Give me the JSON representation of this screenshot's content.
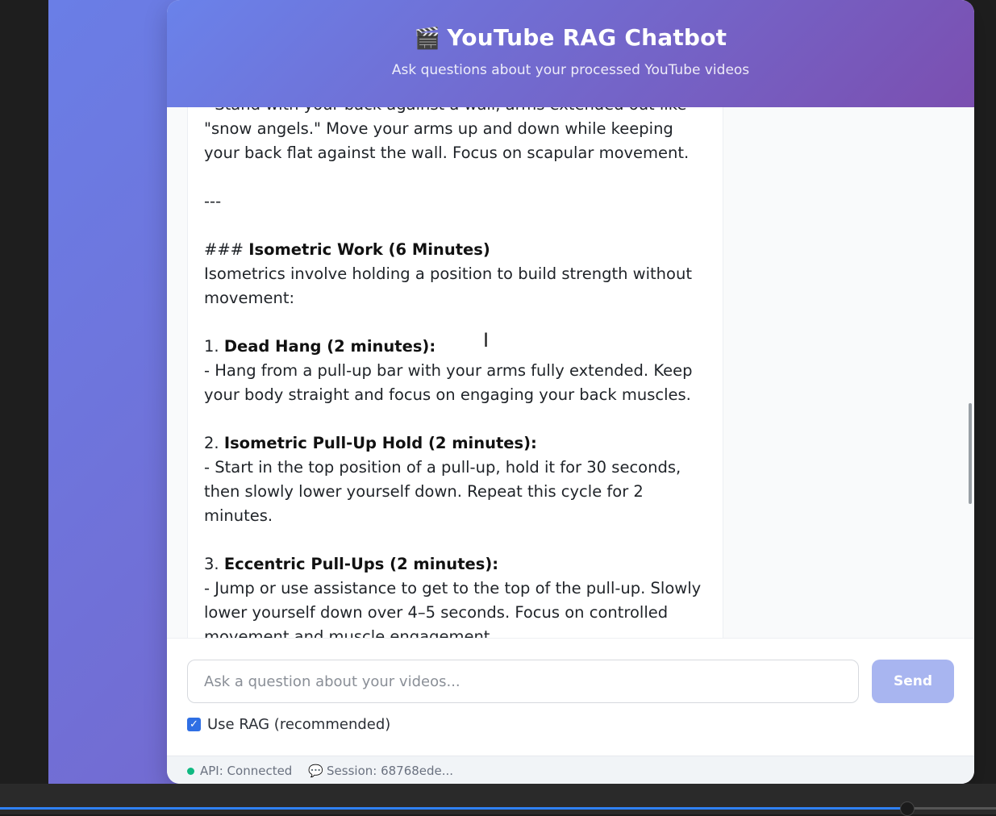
{
  "header": {
    "icon": "clapperboard-icon",
    "icon_glyph": "🎬",
    "title": "YouTube RAG Chatbot",
    "subtitle": "Ask questions about your processed YouTube videos"
  },
  "message": {
    "partial_top": "- Stand with your back against a wall, arms extended out like \"snow angels.\" Move your arms up and down while keeping your back flat against the wall. Focus on scapular movement.",
    "divider": "---",
    "section_prefix": "### ",
    "section_title": "Isometric Work (6 Minutes)",
    "section_intro": "Isometrics involve holding a position to build strength without movement:",
    "items": [
      {
        "number": "1. ",
        "title": "Dead Hang (2 minutes):",
        "text": "- Hang from a pull-up bar with your arms fully extended. Keep your body straight and focus on engaging your back muscles."
      },
      {
        "number": "2. ",
        "title": "Isometric Pull-Up Hold (2 minutes):",
        "text": "- Start in the top position of a pull-up, hold it for 30 seconds, then slowly lower yourself down. Repeat this cycle for 2 minutes."
      },
      {
        "number": "3. ",
        "title": "Eccentric Pull-Ups (2 minutes):",
        "text": "- Jump or use assistance to get to the top of the pull-up. Slowly lower yourself down over 4–5 seconds. Focus on controlled movement and muscle engagement."
      }
    ]
  },
  "input": {
    "placeholder": "Ask a question about your videos...",
    "value": "",
    "send_label": "Send"
  },
  "rag": {
    "label": "Use RAG (recommended)",
    "checked": true
  },
  "status": {
    "api": "API: Connected",
    "session": "Session: 68768ede..."
  },
  "colors": {
    "accent": "#2f6fe4",
    "send_disabled": "#a8b5f0",
    "status_ok": "#10b981"
  },
  "video_progress": 0.91
}
